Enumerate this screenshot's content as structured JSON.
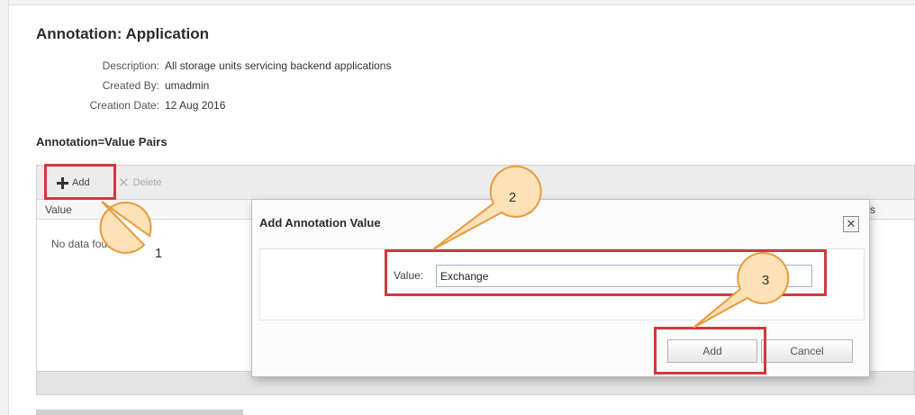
{
  "page": {
    "title": "Annotation: Application",
    "meta": [
      {
        "label": "Description:",
        "value": "All storage units servicing backend applications"
      },
      {
        "label": "Created By:",
        "value": "umadmin"
      },
      {
        "label": "Creation Date:",
        "value": "12 Aug 2016"
      }
    ]
  },
  "pairs": {
    "section_title": "Annotation=Value Pairs",
    "toolbar": {
      "add_label": "Add",
      "delete_label": "Delete"
    },
    "columns": {
      "value": "Value",
      "partial": "s"
    },
    "empty_text": "No data found"
  },
  "dialog": {
    "title": "Add Annotation Value",
    "close_glyph": "✕",
    "value_label": "Value:",
    "value_input": "Exchange",
    "add_button": "Add",
    "cancel_button": "Cancel"
  },
  "callouts": [
    "1",
    "2",
    "3"
  ],
  "colors": {
    "highlight": "#d0393e",
    "callout_fill": "#fce2b6",
    "callout_stroke": "#e89a3c"
  }
}
